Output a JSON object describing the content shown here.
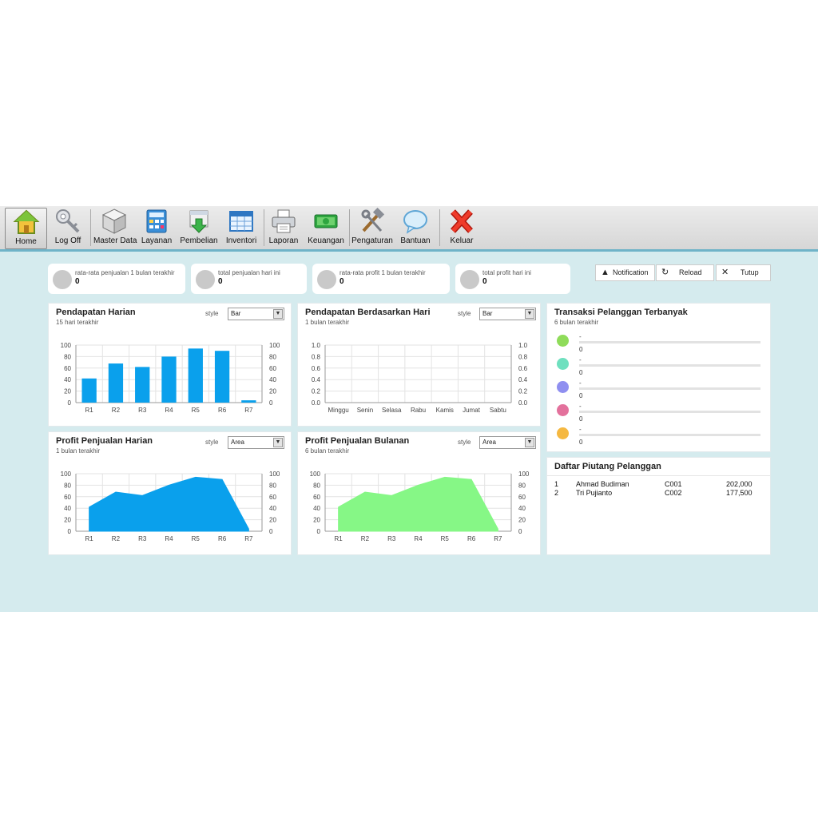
{
  "toolbar": {
    "items": [
      {
        "label": "Home",
        "icon": "home-icon"
      },
      {
        "label": "Log Off",
        "icon": "key-icon"
      },
      {
        "label": "Master Data",
        "icon": "cube-icon"
      },
      {
        "label": "Layanan",
        "icon": "calculator-icon"
      },
      {
        "label": "Pembelian",
        "icon": "download-box-icon"
      },
      {
        "label": "Inventori",
        "icon": "spreadsheet-icon"
      },
      {
        "label": "Laporan",
        "icon": "printer-icon"
      },
      {
        "label": "Keuangan",
        "icon": "money-icon"
      },
      {
        "label": "Pengaturan",
        "icon": "tools-icon"
      },
      {
        "label": "Bantuan",
        "icon": "speech-bubble-icon"
      },
      {
        "label": "Keluar",
        "icon": "close-x-icon"
      }
    ]
  },
  "stats": [
    {
      "caption": "rata-rata penjualan 1 bulan terakhir",
      "value": "0"
    },
    {
      "caption": "total penjualan hari ini",
      "value": "0"
    },
    {
      "caption": "rata-rata profit 1 bulan terakhir",
      "value": "0"
    },
    {
      "caption": "total profit hari ini",
      "value": "0"
    }
  ],
  "actions": {
    "notification": "Notification",
    "reload": "Reload",
    "close": "Tutup"
  },
  "panels": {
    "daily": {
      "title": "Pendapatan Harian",
      "subtitle": "15 hari terakhir",
      "style_label": "style",
      "style_value": "Bar"
    },
    "byday": {
      "title": "Pendapatan Berdasarkan Hari",
      "subtitle": "1 bulan terakhir",
      "style_label": "style",
      "style_value": "Bar"
    },
    "profit_daily": {
      "title": "Profit Penjualan Harian",
      "subtitle": "1 bulan terakhir",
      "style_label": "style",
      "style_value": "Area"
    },
    "profit_monthly": {
      "title": "Profit Penjualan Bulanan",
      "subtitle": "6 bulan terakhir",
      "style_label": "style",
      "style_value": "Area"
    },
    "top_customers": {
      "title": "Transaksi Pelanggan Terbanyak",
      "subtitle": "6 bulan terakhir",
      "rows": [
        {
          "name": "-",
          "count": "0",
          "color": "#8fdc5a"
        },
        {
          "name": "-",
          "count": "0",
          "color": "#6fe0bf"
        },
        {
          "name": "-",
          "count": "0",
          "color": "#8f8ff0"
        },
        {
          "name": "-",
          "count": "0",
          "color": "#e3719c"
        },
        {
          "name": "-",
          "count": "0",
          "color": "#f5b841"
        }
      ]
    },
    "receivables": {
      "title": "Daftar Piutang Pelanggan",
      "rows": [
        {
          "no": "1",
          "name": "Ahmad Budiman",
          "code": "C001",
          "amount": "202,000"
        },
        {
          "no": "2",
          "name": "Tri Pujianto",
          "code": "C002",
          "amount": "177,500"
        }
      ]
    }
  },
  "chart_data": [
    {
      "type": "bar",
      "categories": [
        "R1",
        "R2",
        "R3",
        "R4",
        "R5",
        "R6",
        "R7"
      ],
      "values": [
        42,
        68,
        62,
        80,
        94,
        90,
        4
      ],
      "ylim": [
        0,
        100
      ],
      "ticks": [
        "0",
        "20",
        "40",
        "60",
        "80",
        "100"
      ],
      "color": "#0aa0ec",
      "grid": true
    },
    {
      "type": "bar",
      "categories": [
        "Minggu",
        "Senin",
        "Selasa",
        "Rabu",
        "Kamis",
        "Jumat",
        "Sabtu"
      ],
      "values": [
        0,
        0,
        0,
        0,
        0,
        0,
        0
      ],
      "ylim": [
        0,
        1
      ],
      "ticks": [
        "0.0",
        "0.2",
        "0.4",
        "0.6",
        "0.8",
        "1.0"
      ],
      "color": "#0aa0ec",
      "grid": true
    },
    {
      "type": "area",
      "categories": [
        "R1",
        "R2",
        "R3",
        "R4",
        "R5",
        "R6",
        "R7"
      ],
      "values": [
        42,
        68,
        62,
        80,
        94,
        90,
        4
      ],
      "ylim": [
        0,
        100
      ],
      "ticks": [
        "0",
        "20",
        "40",
        "60",
        "80",
        "100"
      ],
      "color": "#0aa0ec",
      "grid": true
    },
    {
      "type": "area",
      "categories": [
        "R1",
        "R2",
        "R3",
        "R4",
        "R5",
        "R6",
        "R7"
      ],
      "values": [
        42,
        68,
        62,
        80,
        94,
        90,
        4
      ],
      "ylim": [
        0,
        100
      ],
      "ticks": [
        "0",
        "20",
        "40",
        "60",
        "80",
        "100"
      ],
      "color": "#86f786",
      "grid": true
    }
  ]
}
